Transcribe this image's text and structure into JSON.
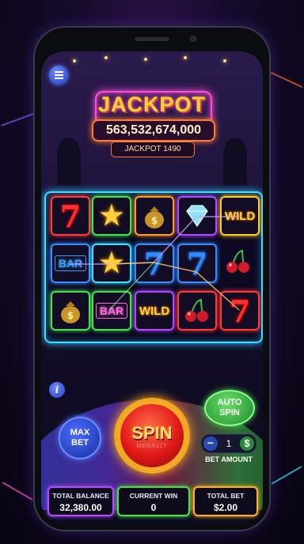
{
  "jackpot": {
    "title": "JACKPOT",
    "amount": "563,532,674,000",
    "subtitle": "JACKPOT 1490"
  },
  "reels": [
    [
      "seven-red",
      "star",
      "money-bag",
      "diamond",
      "wild"
    ],
    [
      "bar",
      "star",
      "seven-blue",
      "seven-blue",
      "cherries"
    ],
    [
      "money-bag",
      "bar",
      "wild",
      "cherries",
      "seven-red"
    ]
  ],
  "symbols": {
    "seven": "7",
    "bar": "BAR",
    "wild": "WILD"
  },
  "controls": {
    "max_bet": [
      "MAX",
      "BET"
    ],
    "spin": "SPIN",
    "spin_sub": "MEGA11T",
    "auto_spin": [
      "AUTO",
      "SPIN"
    ],
    "bet_value": "1",
    "minus": "−",
    "plus": "$",
    "bet_label": "BET AMOUNT",
    "info": "i"
  },
  "stats": [
    {
      "label": "TOTAL BALANCE",
      "value": "32,380.00",
      "color": "#b44aff"
    },
    {
      "label": "CURRENT WIN",
      "value": "0",
      "color": "#4ae04a"
    },
    {
      "label": "TOTAL BET",
      "value": "$2.00",
      "color": "#ffb020"
    }
  ]
}
